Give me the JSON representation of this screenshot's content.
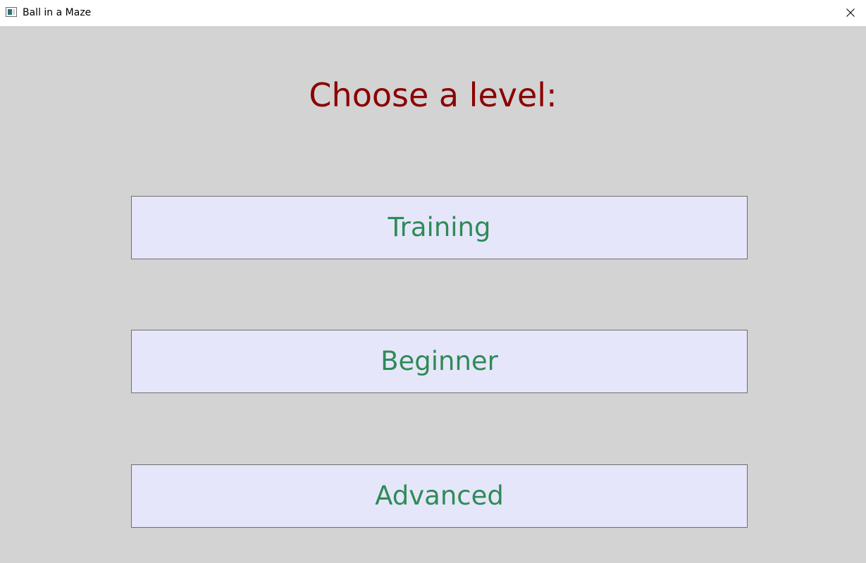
{
  "window": {
    "title": "Ball in a Maze",
    "icon": "app-window-icon",
    "close_icon": "close-icon"
  },
  "main": {
    "heading": "Choose a level:",
    "levels": [
      {
        "label": "Training"
      },
      {
        "label": "Beginner"
      },
      {
        "label": "Advanced"
      }
    ]
  },
  "colors": {
    "background": "#d3d3d3",
    "heading": "#8b0000",
    "button_background": "#e6e6fa",
    "button_text": "#2e8b57",
    "button_border": "#6e6e6e"
  }
}
